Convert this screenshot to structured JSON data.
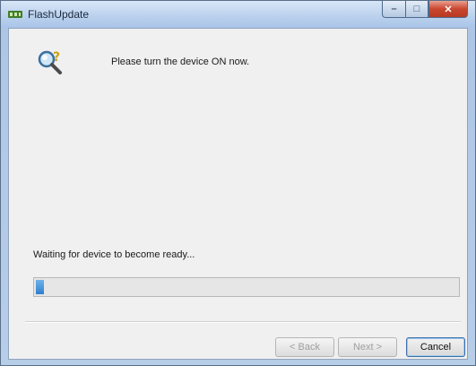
{
  "window": {
    "title": "FlashUpdate",
    "minimize_label": "–",
    "maximize_label": "□",
    "close_label": "✕"
  },
  "icons": {
    "app": "flash-update-app-icon",
    "prompt": "device-search-icon"
  },
  "main": {
    "prompt_text": "Please turn the device ON now.",
    "status_text": "Waiting for device to become ready...",
    "progress_fraction": 0.02
  },
  "buttons": {
    "back_label": "< Back",
    "next_label": "Next >",
    "cancel_label": "Cancel"
  },
  "colors": {
    "progress_fill": "#2f7fcf",
    "close_button": "#c9462f"
  }
}
